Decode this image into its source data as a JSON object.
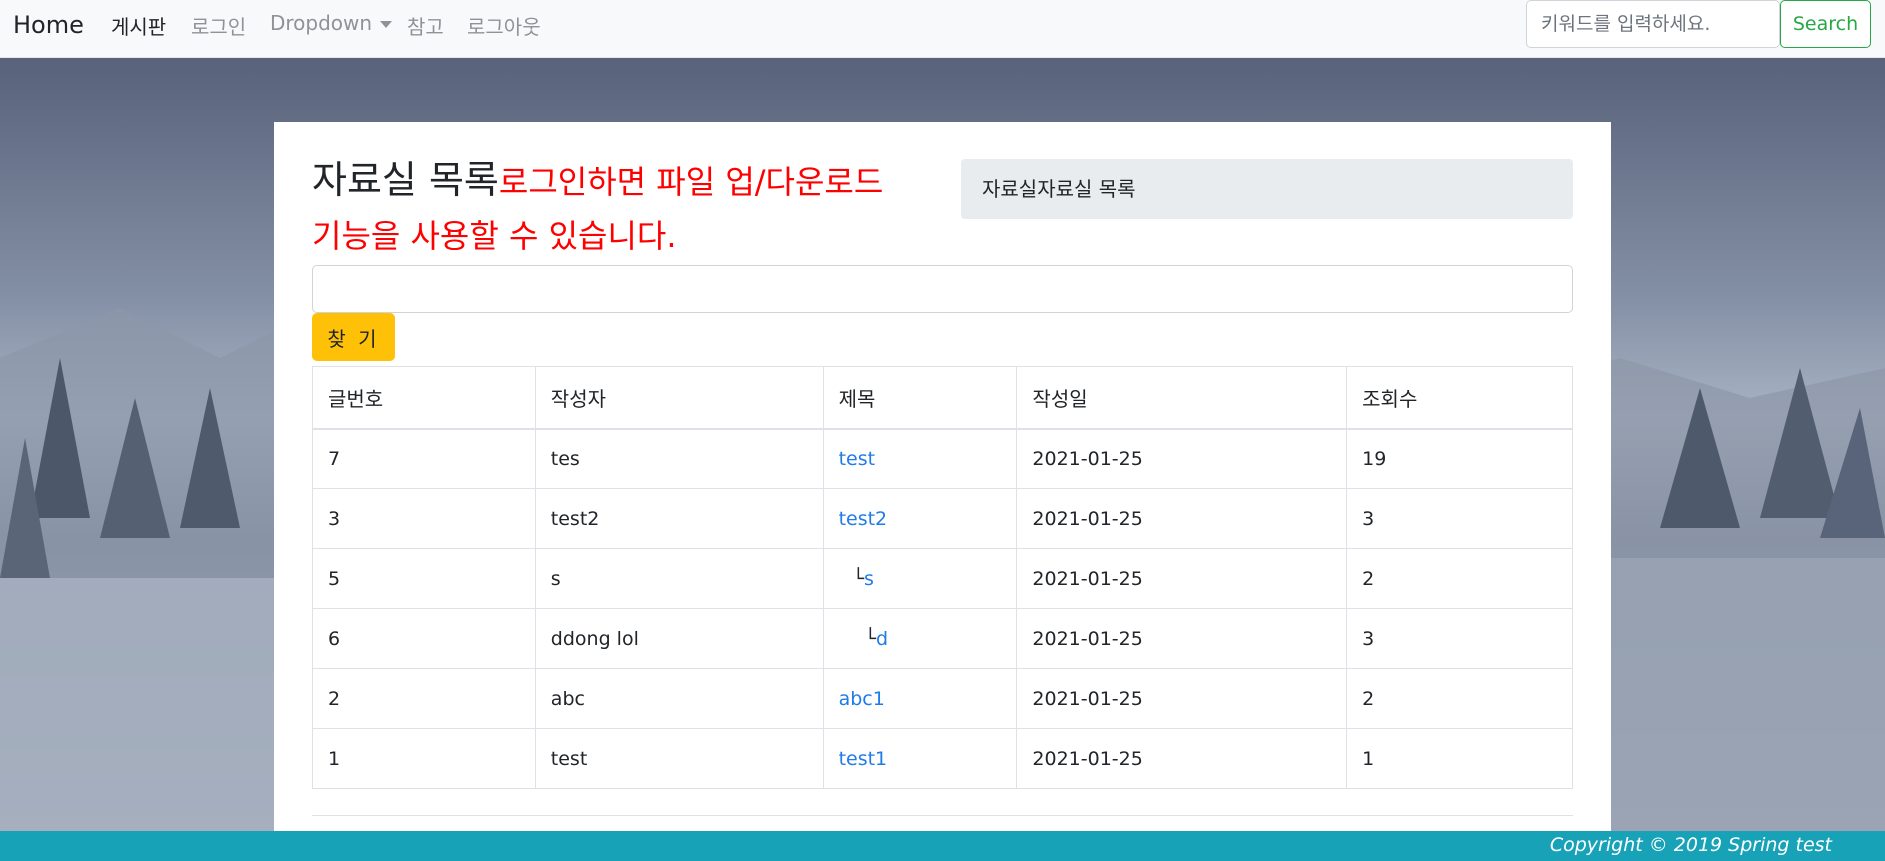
{
  "navbar": {
    "brand": "Home",
    "links": [
      {
        "label": "게시판",
        "active": true
      },
      {
        "label": "로그인",
        "active": false
      },
      {
        "label": "Dropdown",
        "active": false
      },
      {
        "label": "참고",
        "active": false
      },
      {
        "label": "로그아웃",
        "active": false
      }
    ],
    "search_placeholder": "키워드를 입력하세요.",
    "search_button": "Search"
  },
  "page": {
    "title": "자료실 목록",
    "login_note": "로그인하면 파일 업/다운로드 기능을 사용할 수 있습니다.",
    "breadcrumb": "자료실자료실 목록",
    "keyword_value": "",
    "find_button": "찾 기"
  },
  "table": {
    "headers": [
      "글번호",
      "작성자",
      "제목",
      "작성일",
      "조회수"
    ],
    "rows": [
      {
        "no": "7",
        "writer": "tes",
        "reply": "",
        "title": "test",
        "date": "2021-01-25",
        "views": "19"
      },
      {
        "no": "3",
        "writer": "test2",
        "reply": "",
        "title": "test2",
        "date": "2021-01-25",
        "views": "3"
      },
      {
        "no": "5",
        "writer": "s",
        "reply": "└",
        "title": "s",
        "date": "2021-01-25",
        "views": "2"
      },
      {
        "no": "6",
        "writer": "ddong lol",
        "reply": "└",
        "title": "d",
        "date": "2021-01-25",
        "views": "3"
      },
      {
        "no": "2",
        "writer": "abc",
        "reply": "",
        "title": "abc1",
        "date": "2021-01-25",
        "views": "2"
      },
      {
        "no": "1",
        "writer": "test",
        "reply": "",
        "title": "test1",
        "date": "2021-01-25",
        "views": "1"
      }
    ]
  },
  "footer": {
    "copyright": "Copyright © 2019 Spring test"
  },
  "colors": {
    "accent_link": "#1e7be8",
    "note_red": "#ff0000",
    "find_button": "#ffc107",
    "search_green": "#28a745",
    "footer": "#17a2b8"
  }
}
